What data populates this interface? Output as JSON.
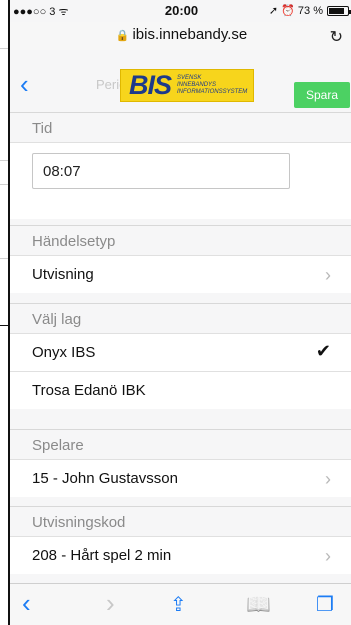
{
  "status_bar": {
    "carrier": "●●●○○ 3 ᯤ",
    "time": "20:00",
    "right": "➚ ⏰ 73 %"
  },
  "browser": {
    "url": "ibis.innebandy.se",
    "lock_icon": "🔒",
    "reload_icon": "↻"
  },
  "header": {
    "back_icon": "‹",
    "logo_text": "BIS",
    "logo_sub_1": "SVENSK",
    "logo_sub_2": "INNEBANDYS",
    "logo_sub_3": "INFORMATIONSSYSTEM",
    "background_period": "Period 2",
    "save_label": "Spara"
  },
  "form": {
    "time": {
      "label": "Tid",
      "value": "08:07"
    },
    "event_type": {
      "label": "Händelsetyp",
      "value": "Utvisning"
    },
    "team": {
      "label": "Välj lag",
      "options": [
        {
          "name": "Onyx IBS",
          "selected": true
        },
        {
          "name": "Trosa Edanö IBK",
          "selected": false
        }
      ]
    },
    "player": {
      "label": "Spelare",
      "value": "15 - John Gustavsson"
    },
    "penalty_code": {
      "label": "Utvisningskod",
      "value": "208 - Hårt spel 2 min"
    }
  },
  "toolbar": {
    "back_icon": "‹",
    "forward_icon": "›",
    "share_icon": "⇪",
    "bookmarks_icon": "📖",
    "tabs_icon": "❐"
  },
  "colors": {
    "accent": "#1c7cf4",
    "save": "#4cd163",
    "logo_bg": "#f7d51c",
    "logo_text": "#1d3a8a"
  }
}
